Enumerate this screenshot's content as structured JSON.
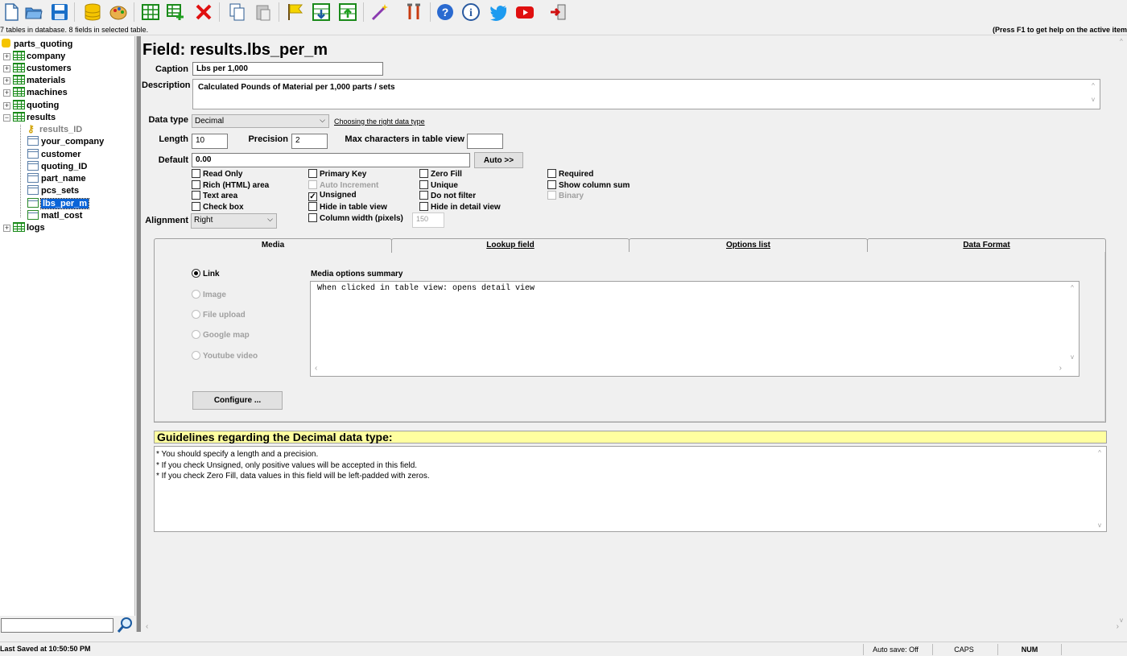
{
  "status_top": {
    "left": "7 tables in database. 8 fields in selected table.",
    "right": "(Press F1 to get help on the active item"
  },
  "tree": {
    "root": "parts_quoting",
    "tables": [
      "company",
      "customers",
      "materials",
      "machines",
      "quoting"
    ],
    "results_table": "results",
    "fields": [
      "results_ID",
      "your_company",
      "customer",
      "quoting_ID",
      "part_name",
      "pcs_sets",
      "lbs_per_m",
      "matl_cost"
    ],
    "last_table": "logs",
    "selected_field": "lbs_per_m"
  },
  "field": {
    "title": "Field: results.lbs_per_m",
    "caption_label": "Caption",
    "caption_value": "Lbs per 1,000",
    "description_label": "Description",
    "description_value": "Calculated Pounds of Material per 1,000 parts / sets",
    "datatype_label": "Data type",
    "datatype_value": "Decimal",
    "datatype_link": "Choosing the right data type",
    "length_label": "Length",
    "length_value": "10",
    "precision_label": "Precision",
    "precision_value": "2",
    "maxchars_label": "Max characters in table view",
    "maxchars_value": "",
    "default_label": "Default",
    "default_value": "0.00",
    "auto_button": "Auto >>",
    "alignment_label": "Alignment",
    "alignment_value": "Right",
    "colwidth_value": "150"
  },
  "checkboxes": {
    "read_only": "Read Only",
    "rich_html": "Rich (HTML) area",
    "text_area": "Text area",
    "check_box": "Check box",
    "primary_key": "Primary Key",
    "auto_increment": "Auto Increment",
    "unsigned": "Unsigned",
    "hide_table": "Hide in table view",
    "column_width": "Column width (pixels)",
    "zero_fill": "Zero Fill",
    "unique": "Unique",
    "do_not_filter": "Do not filter",
    "hide_detail": "Hide in detail view",
    "required": "Required",
    "show_sum": "Show column sum",
    "binary": "Binary",
    "checked": [
      "unsigned"
    ]
  },
  "tabs": [
    "Media",
    "Lookup field",
    "Options list",
    "Data Format"
  ],
  "media": {
    "options": [
      "Link",
      "Image",
      "File upload",
      "Google map",
      "Youtube video"
    ],
    "selected": "Link",
    "summary_label": "Media options summary",
    "summary_text": "When clicked in table view: opens detail view",
    "configure_button": "Configure ..."
  },
  "guidelines": {
    "title": "Guidelines regarding the Decimal data type:",
    "lines": [
      "* You should specify a length and a precision.",
      "* If you check Unsigned, only positive values will be accepted in this field.",
      "* If you check Zero Fill, data values in this field will be left-padded with zeros."
    ]
  },
  "statusbar": {
    "last_saved": "Last Saved at 10:50:50 PM",
    "auto_save": "Auto save: Off",
    "caps": "CAPS",
    "num": "NUM"
  },
  "colors": {
    "accent": "#0a64d8",
    "guideline_bg": "#ffffa0"
  }
}
